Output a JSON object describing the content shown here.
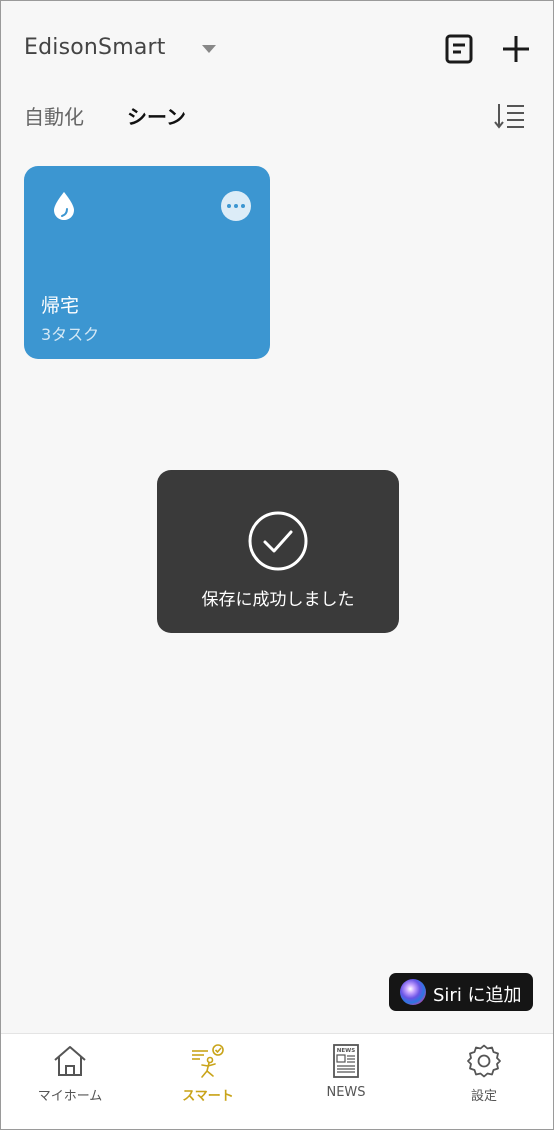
{
  "header": {
    "home_name": "EdisonSmart",
    "dropdown_icon": "triangle-down-icon",
    "notes_icon": "notes-icon",
    "add_icon": "plus-icon"
  },
  "tabs": {
    "automation": "自動化",
    "scene": "シーン",
    "sort_icon": "sort-icon",
    "active": "scene"
  },
  "scenes": [
    {
      "name": "帰宅",
      "tasks": "3タスク",
      "icon": "water-drop-icon",
      "color": "#3c96d1"
    }
  ],
  "toast": {
    "message": "保存に成功しました",
    "icon": "check-circle-icon"
  },
  "siri": {
    "label": "Siri に追加"
  },
  "bottom_nav": {
    "items": [
      {
        "label": "マイホーム",
        "icon": "home-icon"
      },
      {
        "label": "スマート",
        "icon": "smart-icon"
      },
      {
        "label": "NEWS",
        "icon": "newspaper-icon"
      },
      {
        "label": "設定",
        "icon": "gear-icon"
      }
    ],
    "active_color": "#c9a41a"
  }
}
